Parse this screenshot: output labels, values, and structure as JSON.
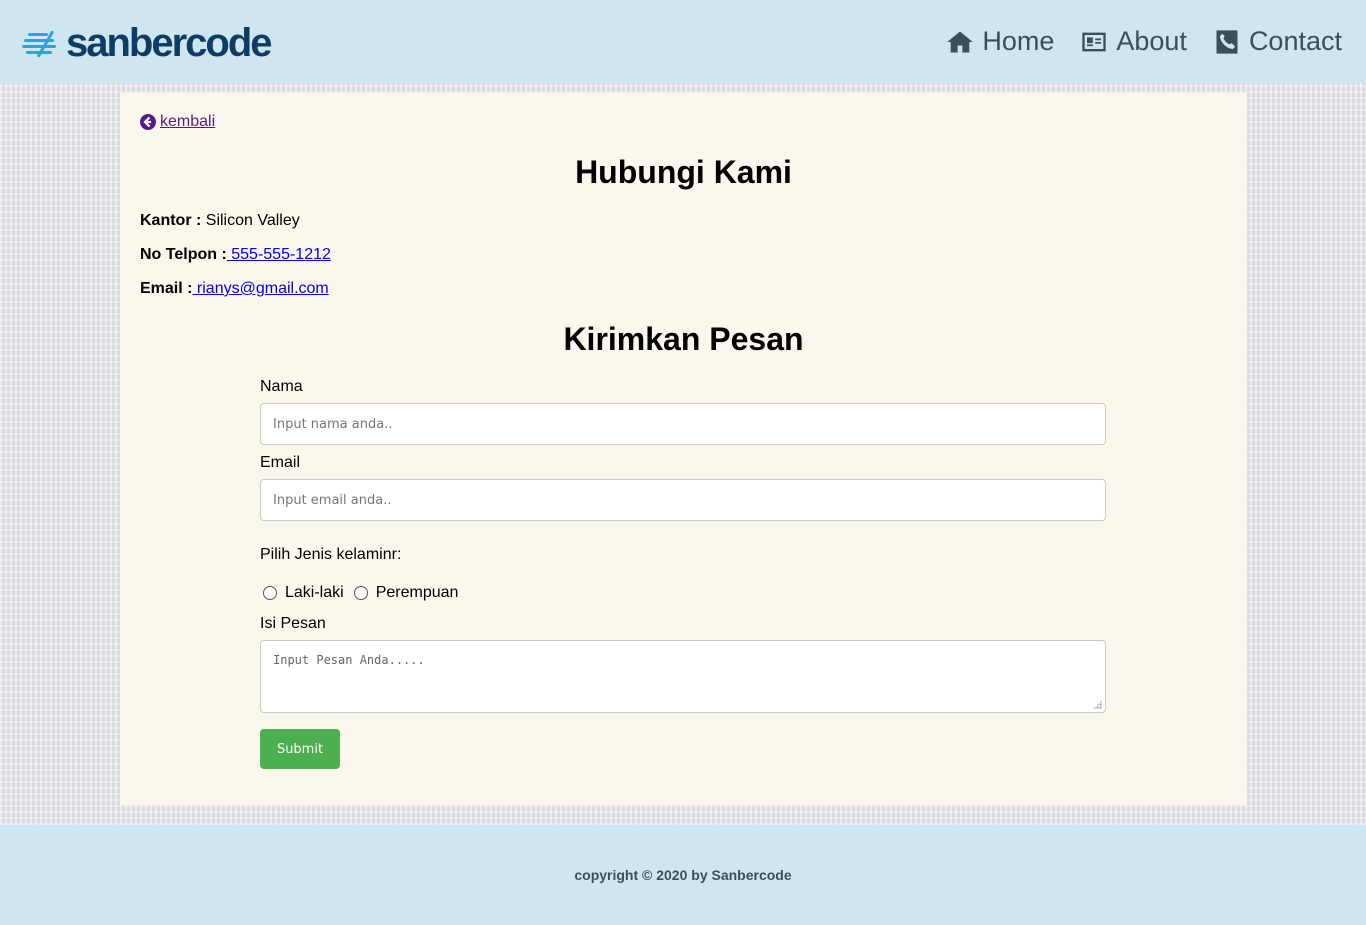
{
  "brand": {
    "name": "sanbercode"
  },
  "nav": {
    "items": [
      {
        "label": "Home",
        "icon": "home-icon"
      },
      {
        "label": "About",
        "icon": "id-card-icon"
      },
      {
        "label": "Contact",
        "icon": "phone-icon"
      }
    ]
  },
  "page": {
    "back_label": " kembali",
    "title": "Hubungi Kami",
    "info": {
      "office_label": "Kantor :",
      "office_value": " Silicon Valley",
      "phone_label": "No Telpon :",
      "phone_value": " 555-555-1212",
      "email_label": "Email :",
      "email_value": " rianys@gmail.com"
    },
    "form_title": "Kirimkan Pesan",
    "form": {
      "name_label": "Nama",
      "name_placeholder": "Input nama anda..",
      "email_label": "Email",
      "email_placeholder": "Input email anda..",
      "gender_label": "Pilih Jenis kelaminr:",
      "gender_options": [
        "Laki-laki",
        "Perempuan"
      ],
      "message_label": "Isi Pesan",
      "message_placeholder": "Input Pesan Anda.....",
      "submit_label": "Submit"
    }
  },
  "footer": {
    "text": "copyright © 2020 by Sanbercode"
  },
  "colors": {
    "navbar_bg": "#cfe6f1",
    "card_bg": "#fbf7ec",
    "submit_bg": "#4caf50",
    "nav_text": "#39505c",
    "link": "#0000ee",
    "visited_link": "#551a8b"
  }
}
